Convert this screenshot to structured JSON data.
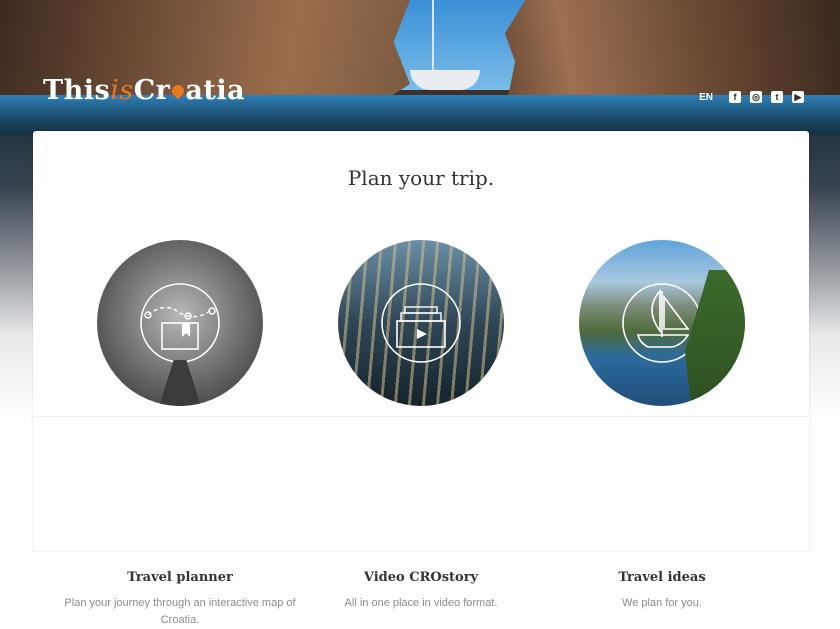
{
  "header": {
    "logo": {
      "part1": "This",
      "part2": "is",
      "part3": "Cr",
      "part4": "atia"
    },
    "language": "EN",
    "social": [
      {
        "name": "facebook-icon",
        "glyph": "f"
      },
      {
        "name": "instagram-icon",
        "glyph": "◎"
      },
      {
        "name": "twitter-icon",
        "glyph": "t"
      },
      {
        "name": "youtube-icon",
        "glyph": "▶"
      }
    ]
  },
  "main": {
    "title": "Plan your trip.",
    "items": [
      {
        "title": "Travel planner",
        "description": "Plan your journey through an interactive map of Croatia.",
        "icon": "map-route-icon"
      },
      {
        "title": "Video CROstory",
        "description": "All in one place in video format.",
        "icon": "video-stack-icon"
      },
      {
        "title": "Travel ideas",
        "description": "We plan for you.",
        "icon": "sailboat-icon"
      }
    ]
  },
  "colors": {
    "accent": "#e87722",
    "text": "#333333",
    "muted": "#8c8c8c"
  }
}
